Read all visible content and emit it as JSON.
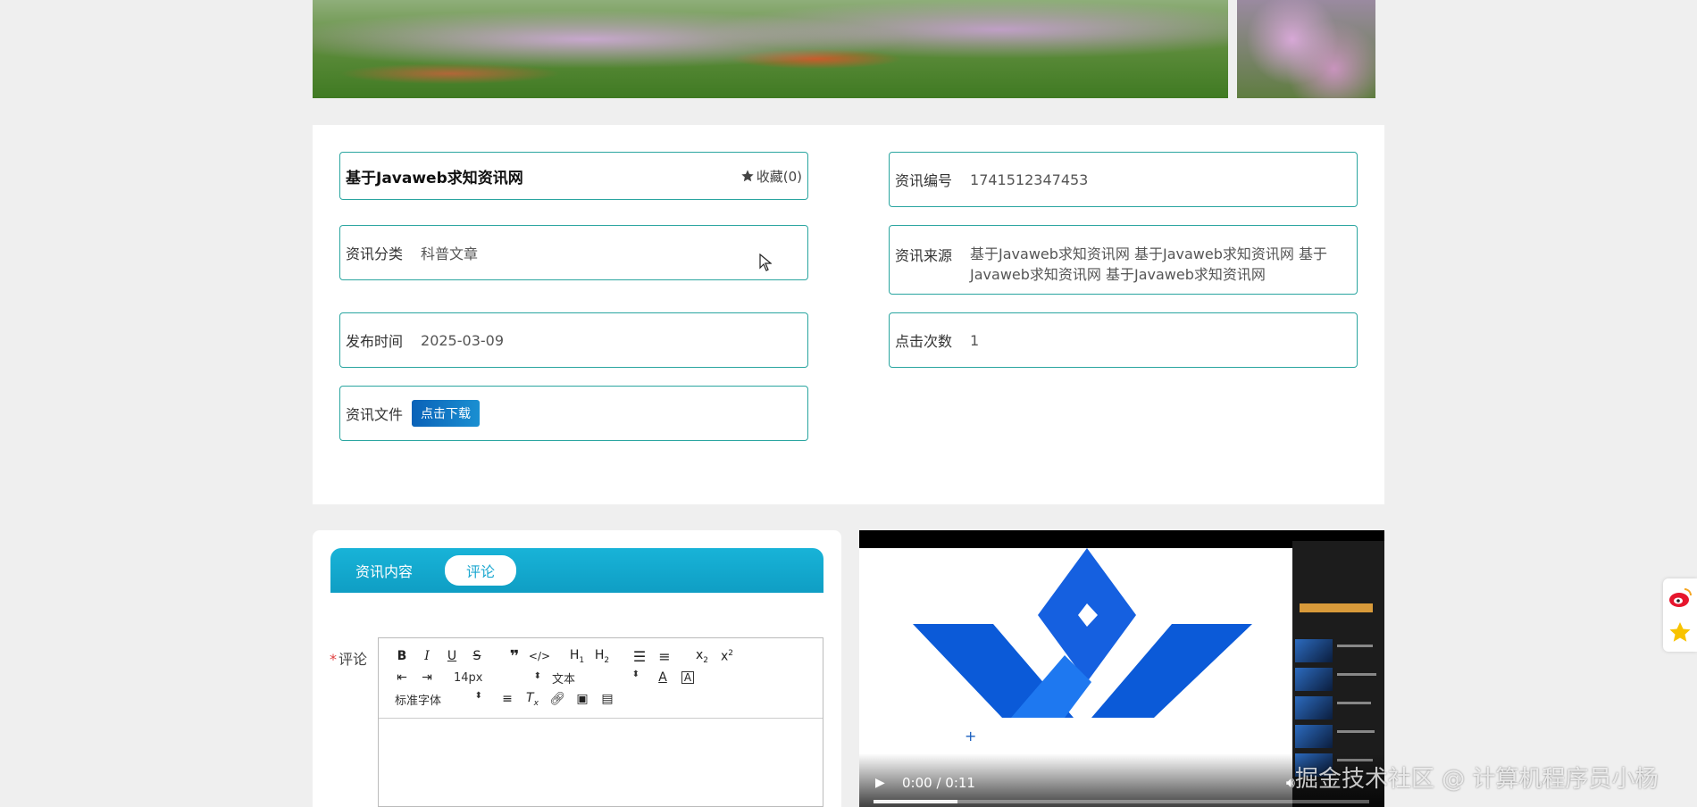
{
  "info": {
    "title": "基于Javaweb求知资讯网",
    "favorite_label": "收藏(0)",
    "fields": {
      "number_label": "资讯编号",
      "number_value": "1741512347453",
      "category_label": "资讯分类",
      "category_value": "科普文章",
      "source_label": "资讯来源",
      "source_value": "基于Javaweb求知资讯网 基于Javaweb求知资讯网 基于Javaweb求知资讯网 基于Javaweb求知资讯网",
      "publish_label": "发布时间",
      "publish_value": "2025-03-09",
      "clicks_label": "点击次数",
      "clicks_value": "1",
      "file_label": "资讯文件",
      "download_label": "点击下载"
    }
  },
  "tabs": [
    {
      "label": "资讯内容",
      "active": false
    },
    {
      "label": "评论",
      "active": true
    }
  ],
  "comment": {
    "required_mark": "*",
    "label": "评论"
  },
  "editor": {
    "font_size": "14px",
    "text_style": "文本",
    "font_family": "标准字体"
  },
  "video": {
    "time": "0:00 / 0:11",
    "progress": 0.17
  },
  "watermark": "掘金技术社区 @ 计算机程序员小杨",
  "colors": {
    "field_border": "#2aa5a0",
    "tab_bar": "#13a9d0",
    "download_button": "#0a62b8"
  },
  "icons": [
    "star-icon",
    "play-icon",
    "volume-icon",
    "weibo-icon",
    "qzone-icon"
  ]
}
